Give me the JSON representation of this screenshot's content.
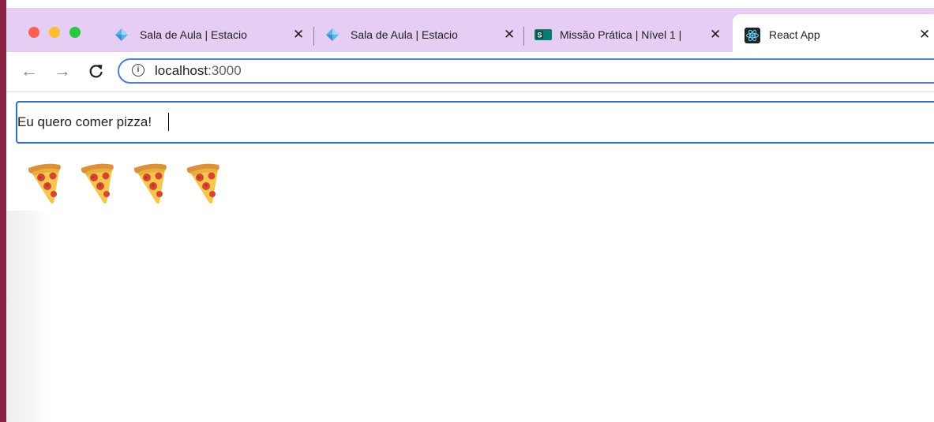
{
  "browser": {
    "tabs": [
      {
        "title": "Sala de Aula | Estacio",
        "icon": "diamond-icon",
        "active": false
      },
      {
        "title": "Sala de Aula | Estacio",
        "icon": "diamond-icon",
        "active": false
      },
      {
        "title": "Missão Prática | Nível 1 |",
        "icon": "sway-icon",
        "active": false
      },
      {
        "title": "React App",
        "icon": "react-icon",
        "active": true
      }
    ],
    "address": {
      "host": "localhost",
      "port": ":3000"
    }
  },
  "app": {
    "input_value": "Eu quero comer pizza!",
    "emoji": "🍕",
    "emoji_count": 4
  },
  "colors": {
    "tab_strip": "#e6cdf4",
    "focus_ring": "#2f6fc8",
    "omnibox_ring": "#4d7fd6",
    "window_edge": "#8a2343"
  }
}
